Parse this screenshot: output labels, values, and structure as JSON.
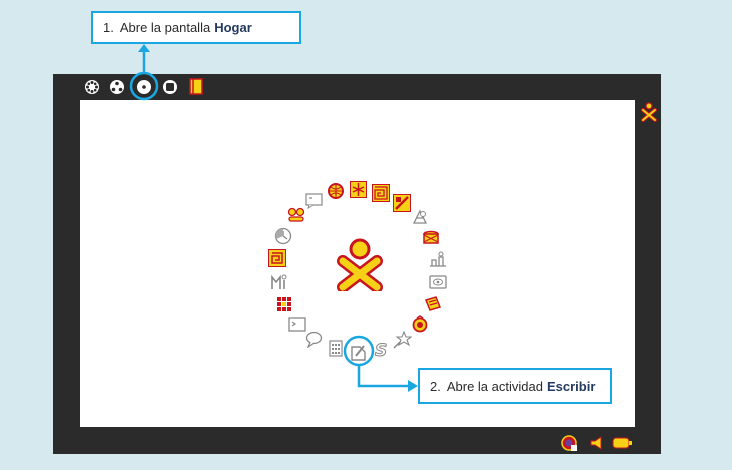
{
  "callouts": {
    "step1": {
      "number": "1.",
      "text": "Abre la pantalla",
      "bold": "Hogar"
    },
    "step2": {
      "number": "2.",
      "text": "Abre la actividad",
      "bold": "Escribir"
    }
  },
  "toolbar": {
    "views": [
      {
        "name": "neighborhood-view-icon"
      },
      {
        "name": "group-view-icon"
      },
      {
        "name": "home-view-icon",
        "selected": true
      },
      {
        "name": "activity-view-icon"
      },
      {
        "name": "journal-icon"
      }
    ]
  },
  "home": {
    "center_icon": "xo-person-icon",
    "ring_icons": [
      "browse-icon",
      "turtle-art-icon",
      "maze-icon",
      "paint-icon",
      "physics-icon",
      "tamtam-icon",
      "tamtam-jam-icon",
      "record-icon",
      "read-icon",
      "speak-icon",
      "implode-icon",
      "sugar-star-icon",
      "write-icon",
      "calculate-icon",
      "chat-icon",
      "terminal-icon",
      "memorize-icon",
      "measure-icon",
      "labyrinth-icon",
      "clock-icon",
      "speak-face-icon",
      "log-icon"
    ],
    "highlight": "write-icon"
  },
  "frame_tray": {
    "icons": [
      "network-icon",
      "volume-icon",
      "battery-icon"
    ]
  },
  "colors": {
    "accent": "#1aa6e0",
    "frame": "#2b2b2b",
    "xo_fill": "#f7d116",
    "xo_stroke": "#c8141f",
    "background": "#d6e9ee"
  }
}
